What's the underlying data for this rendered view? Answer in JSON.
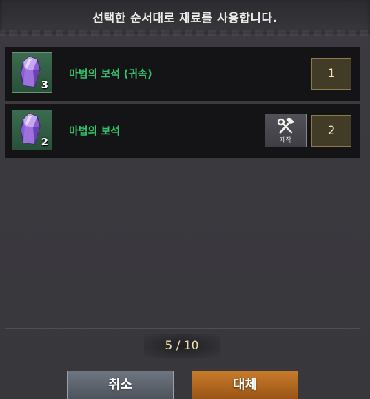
{
  "header": {
    "title": "선택한 순서대로 재료를 사용합니다."
  },
  "materials": [
    {
      "name": "마법의 보석 (귀속)",
      "count": "3",
      "order": "1",
      "icon": "purple-gem-icon",
      "craftable": false
    },
    {
      "name": "마법의 보석",
      "count": "2",
      "order": "2",
      "icon": "purple-gem-icon",
      "craftable": true
    }
  ],
  "craft": {
    "label": "제작",
    "icon": "hammer-wrench-icon"
  },
  "pagination": {
    "text": "5 / 10"
  },
  "buttons": {
    "cancel": "취소",
    "replace": "대체"
  },
  "colors": {
    "item_name": "#33c16b",
    "slot_bg": "#3b6c4e",
    "order_box": "#423b26",
    "replace_button": "#c77a2a",
    "cancel_button": "#6f7580"
  }
}
